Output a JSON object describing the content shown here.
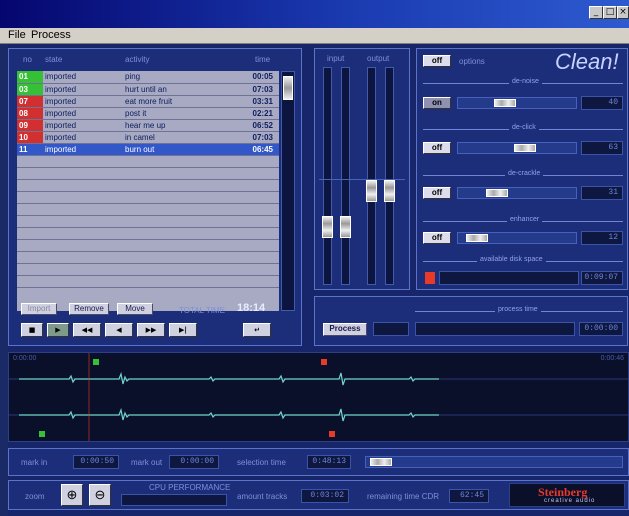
{
  "window": {
    "title": "",
    "minimize": "_",
    "maximize": "□",
    "close": "×"
  },
  "menu": {
    "file": "File",
    "process": "Process"
  },
  "playlist": {
    "headers": [
      "no",
      "state",
      "activity",
      "time"
    ],
    "rows": [
      {
        "no": "01",
        "status": "imported",
        "title": "ping",
        "time": "00:05",
        "no_color": "#35c035"
      },
      {
        "no": "03",
        "status": "imported",
        "title": "hurt until an",
        "time": "07:03",
        "no_color": "#35c035"
      },
      {
        "no": "07",
        "status": "imported",
        "title": "eat more fruit",
        "time": "03:31",
        "no_color": "#d23030"
      },
      {
        "no": "08",
        "status": "imported",
        "title": "post it",
        "time": "02:21",
        "no_color": "#d23030"
      },
      {
        "no": "09",
        "status": "imported",
        "title": "hear me up",
        "time": "06:52",
        "no_color": "#d23030"
      },
      {
        "no": "10",
        "status": "imported",
        "title": "in camel",
        "time": "07:03",
        "no_color": "#d23030"
      },
      {
        "no": "11",
        "status": "imported",
        "title": "burn out",
        "time": "06:45",
        "no_color": "#d23030"
      }
    ],
    "import_label": "Import",
    "remove_label": "Remove",
    "move_label": "Move",
    "total_time_label": "TOTAL TIME",
    "total_time_value": "18:14"
  },
  "transport": {
    "buttons": [
      "■",
      "▶",
      "◀◀",
      "◀",
      "▶▶",
      "▶|",
      "↵"
    ]
  },
  "meters": {
    "input_label": "input",
    "output_label": "output"
  },
  "clean": {
    "off_label": "off",
    "options_label": "options",
    "logo": "Clean!",
    "denoise": {
      "label": "de-noise",
      "on_label": "on",
      "value": "40"
    },
    "declick": {
      "label": "de-click",
      "off_label": "off",
      "value": "63"
    },
    "decrackle": {
      "label": "de-crackle",
      "off_label": "off",
      "value": "31"
    },
    "enhancer": {
      "label": "enhancer",
      "off_label": "off",
      "value": "12"
    },
    "available": {
      "label": "available disk space",
      "value": "0:09:07"
    }
  },
  "process": {
    "label": "process time",
    "button": "Process",
    "value": "0:00:00"
  },
  "waveform": {
    "left_time": "0:00:00",
    "right_time": "0:00:46"
  },
  "bottom": {
    "mark_in_label": "mark in",
    "mark_in_value": "0:00:50",
    "mark_out_label": "mark out",
    "mark_out_value": "0:00:00",
    "selection_label": "selection time",
    "selection_value": "0:48:13",
    "zoom_label": "zoom",
    "cpu_label": "CPU PERFORMANCE",
    "amount_label": "amount tracks",
    "amount_value": "0:03:02",
    "remaining_label": "remaining time CDR",
    "remaining_value": "62:45",
    "brand": "Steinberg",
    "brand_sub": "creative audio"
  },
  "colors": {
    "accent": "#e83a2a",
    "logo": "#c7d1ff",
    "selection": "#3157c8",
    "wave": "#6fd6c6"
  }
}
